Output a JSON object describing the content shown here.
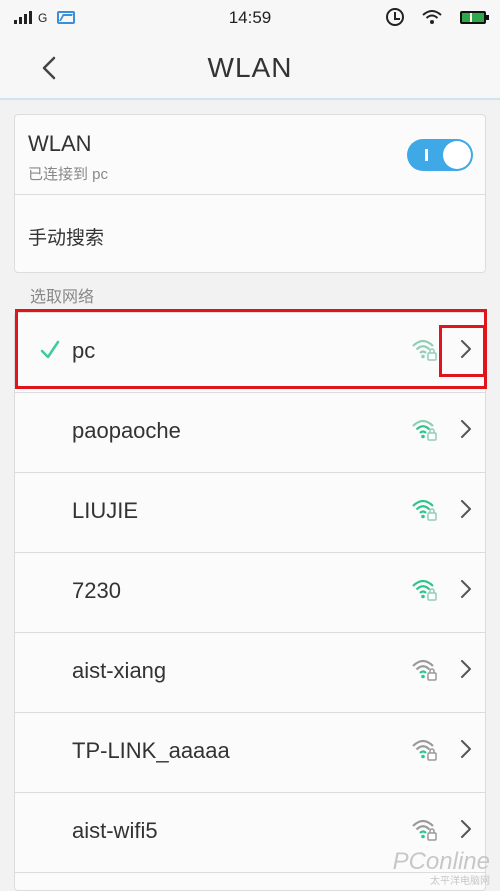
{
  "status_bar": {
    "network_type": "G",
    "time": "14:59",
    "icons": [
      "signal-icon",
      "image-icon",
      "alarm-icon",
      "wifi-icon",
      "battery-icon"
    ]
  },
  "header": {
    "title": "WLAN",
    "back_icon": "chevron-left-icon"
  },
  "wlan_card": {
    "label": "WLAN",
    "status": "已连接到 pc",
    "toggle_on": true,
    "manual_search": "手动搜索"
  },
  "section": {
    "label": "选取网络"
  },
  "networks": [
    {
      "name": "pc",
      "connected": true
    },
    {
      "name": "paopaoche",
      "connected": false
    },
    {
      "name": "LIUJIE",
      "connected": false
    },
    {
      "name": "7230",
      "connected": false
    },
    {
      "name": "aist-xiang",
      "connected": false
    },
    {
      "name": "TP-LINK_aaaaa",
      "connected": false
    },
    {
      "name": "aist-wifi5",
      "connected": false
    }
  ],
  "colors": {
    "accent": "#3ea9e6",
    "check": "#3ecba0",
    "wifi_strong": "#2ec48f",
    "wifi_weak": "#8fcfb6",
    "highlight": "#e0141b"
  },
  "watermark": {
    "main": "PConline",
    "sub": "太平洋电脑网"
  }
}
